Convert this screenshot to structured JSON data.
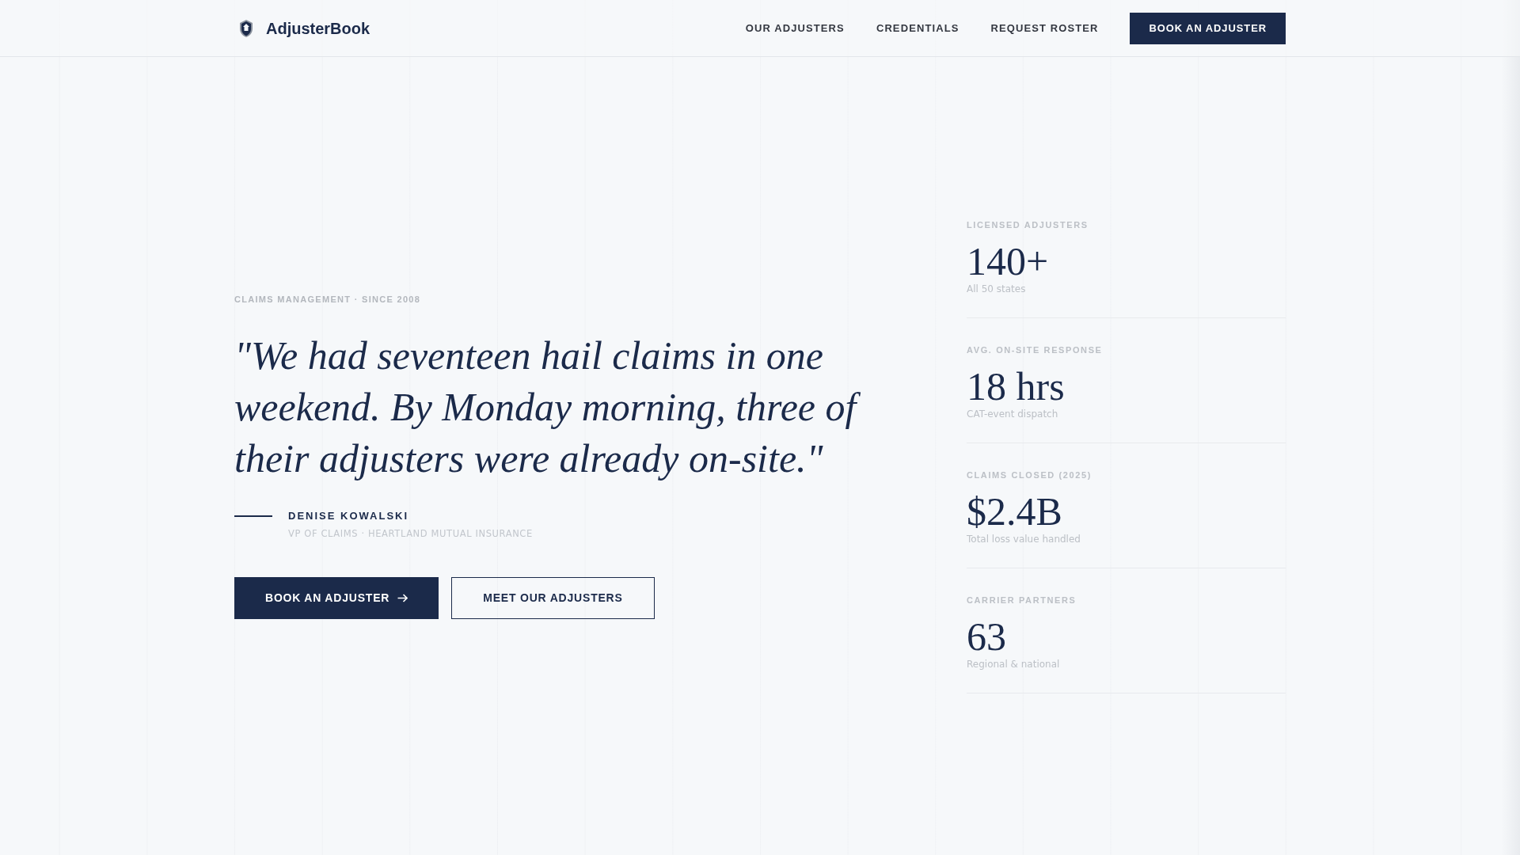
{
  "brand": {
    "name": "AdjusterBook"
  },
  "nav": {
    "links": [
      "OUR ADJUSTERS",
      "CREDENTIALS",
      "REQUEST ROSTER"
    ],
    "cta": "BOOK AN ADJUSTER"
  },
  "hero": {
    "eyebrow": "CLAIMS MANAGEMENT · SINCE 2008",
    "quote": "\"We had seventeen hail claims in one weekend. By Monday morning, three of their adjusters were already on-site.\"",
    "attribution": {
      "name": "DENISE KOWALSKI",
      "title": "VP OF CLAIMS · HEARTLAND MUTUAL INSURANCE"
    },
    "buttons": [
      {
        "label": "BOOK AN ADJUSTER",
        "kind": "primary"
      },
      {
        "label": "MEET OUR ADJUSTERS",
        "kind": "outline"
      }
    ]
  },
  "stats": [
    {
      "label": "LICENSED ADJUSTERS",
      "value": "140+",
      "note": "All 50 states"
    },
    {
      "label": "AVG. ON-SITE RESPONSE",
      "value": "18 hrs",
      "note": "CAT-event dispatch"
    },
    {
      "label": "CLAIMS CLOSED (2025)",
      "value": "$2.4B",
      "note": "Total loss value handled"
    },
    {
      "label": "CARRIER PARTNERS",
      "value": "63",
      "note": "Regional & national"
    }
  ]
}
